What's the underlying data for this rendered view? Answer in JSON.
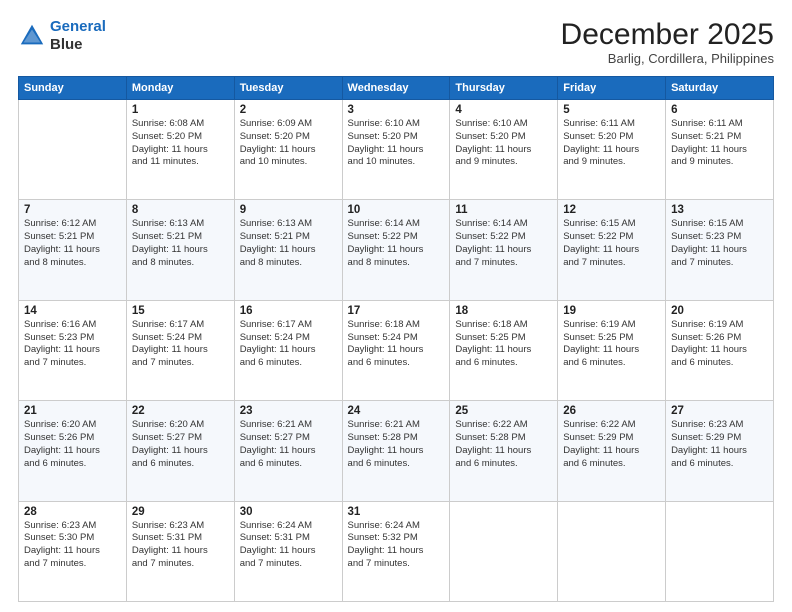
{
  "header": {
    "logo_line1": "General",
    "logo_line2": "Blue",
    "month": "December 2025",
    "location": "Barlig, Cordillera, Philippines"
  },
  "days_of_week": [
    "Sunday",
    "Monday",
    "Tuesday",
    "Wednesday",
    "Thursday",
    "Friday",
    "Saturday"
  ],
  "weeks": [
    [
      {
        "day": null,
        "info": null
      },
      {
        "day": "1",
        "info": "Sunrise: 6:08 AM\nSunset: 5:20 PM\nDaylight: 11 hours\nand 11 minutes."
      },
      {
        "day": "2",
        "info": "Sunrise: 6:09 AM\nSunset: 5:20 PM\nDaylight: 11 hours\nand 10 minutes."
      },
      {
        "day": "3",
        "info": "Sunrise: 6:10 AM\nSunset: 5:20 PM\nDaylight: 11 hours\nand 10 minutes."
      },
      {
        "day": "4",
        "info": "Sunrise: 6:10 AM\nSunset: 5:20 PM\nDaylight: 11 hours\nand 9 minutes."
      },
      {
        "day": "5",
        "info": "Sunrise: 6:11 AM\nSunset: 5:20 PM\nDaylight: 11 hours\nand 9 minutes."
      },
      {
        "day": "6",
        "info": "Sunrise: 6:11 AM\nSunset: 5:21 PM\nDaylight: 11 hours\nand 9 minutes."
      }
    ],
    [
      {
        "day": "7",
        "info": "Sunrise: 6:12 AM\nSunset: 5:21 PM\nDaylight: 11 hours\nand 8 minutes."
      },
      {
        "day": "8",
        "info": "Sunrise: 6:13 AM\nSunset: 5:21 PM\nDaylight: 11 hours\nand 8 minutes."
      },
      {
        "day": "9",
        "info": "Sunrise: 6:13 AM\nSunset: 5:21 PM\nDaylight: 11 hours\nand 8 minutes."
      },
      {
        "day": "10",
        "info": "Sunrise: 6:14 AM\nSunset: 5:22 PM\nDaylight: 11 hours\nand 8 minutes."
      },
      {
        "day": "11",
        "info": "Sunrise: 6:14 AM\nSunset: 5:22 PM\nDaylight: 11 hours\nand 7 minutes."
      },
      {
        "day": "12",
        "info": "Sunrise: 6:15 AM\nSunset: 5:22 PM\nDaylight: 11 hours\nand 7 minutes."
      },
      {
        "day": "13",
        "info": "Sunrise: 6:15 AM\nSunset: 5:23 PM\nDaylight: 11 hours\nand 7 minutes."
      }
    ],
    [
      {
        "day": "14",
        "info": "Sunrise: 6:16 AM\nSunset: 5:23 PM\nDaylight: 11 hours\nand 7 minutes."
      },
      {
        "day": "15",
        "info": "Sunrise: 6:17 AM\nSunset: 5:24 PM\nDaylight: 11 hours\nand 7 minutes."
      },
      {
        "day": "16",
        "info": "Sunrise: 6:17 AM\nSunset: 5:24 PM\nDaylight: 11 hours\nand 6 minutes."
      },
      {
        "day": "17",
        "info": "Sunrise: 6:18 AM\nSunset: 5:24 PM\nDaylight: 11 hours\nand 6 minutes."
      },
      {
        "day": "18",
        "info": "Sunrise: 6:18 AM\nSunset: 5:25 PM\nDaylight: 11 hours\nand 6 minutes."
      },
      {
        "day": "19",
        "info": "Sunrise: 6:19 AM\nSunset: 5:25 PM\nDaylight: 11 hours\nand 6 minutes."
      },
      {
        "day": "20",
        "info": "Sunrise: 6:19 AM\nSunset: 5:26 PM\nDaylight: 11 hours\nand 6 minutes."
      }
    ],
    [
      {
        "day": "21",
        "info": "Sunrise: 6:20 AM\nSunset: 5:26 PM\nDaylight: 11 hours\nand 6 minutes."
      },
      {
        "day": "22",
        "info": "Sunrise: 6:20 AM\nSunset: 5:27 PM\nDaylight: 11 hours\nand 6 minutes."
      },
      {
        "day": "23",
        "info": "Sunrise: 6:21 AM\nSunset: 5:27 PM\nDaylight: 11 hours\nand 6 minutes."
      },
      {
        "day": "24",
        "info": "Sunrise: 6:21 AM\nSunset: 5:28 PM\nDaylight: 11 hours\nand 6 minutes."
      },
      {
        "day": "25",
        "info": "Sunrise: 6:22 AM\nSunset: 5:28 PM\nDaylight: 11 hours\nand 6 minutes."
      },
      {
        "day": "26",
        "info": "Sunrise: 6:22 AM\nSunset: 5:29 PM\nDaylight: 11 hours\nand 6 minutes."
      },
      {
        "day": "27",
        "info": "Sunrise: 6:23 AM\nSunset: 5:29 PM\nDaylight: 11 hours\nand 6 minutes."
      }
    ],
    [
      {
        "day": "28",
        "info": "Sunrise: 6:23 AM\nSunset: 5:30 PM\nDaylight: 11 hours\nand 7 minutes."
      },
      {
        "day": "29",
        "info": "Sunrise: 6:23 AM\nSunset: 5:31 PM\nDaylight: 11 hours\nand 7 minutes."
      },
      {
        "day": "30",
        "info": "Sunrise: 6:24 AM\nSunset: 5:31 PM\nDaylight: 11 hours\nand 7 minutes."
      },
      {
        "day": "31",
        "info": "Sunrise: 6:24 AM\nSunset: 5:32 PM\nDaylight: 11 hours\nand 7 minutes."
      },
      {
        "day": null,
        "info": null
      },
      {
        "day": null,
        "info": null
      },
      {
        "day": null,
        "info": null
      }
    ]
  ]
}
